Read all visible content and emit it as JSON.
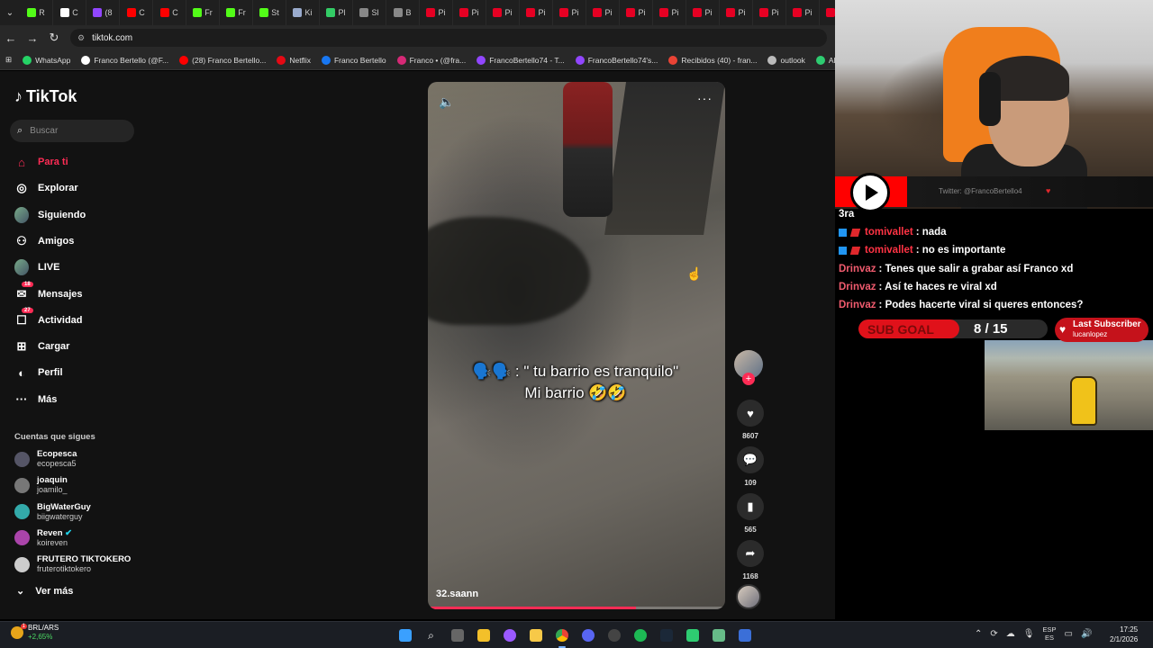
{
  "browser": {
    "tabs": [
      {
        "label": "R",
        "color": "#53fc18"
      },
      {
        "label": "C",
        "color": "#ffffff"
      },
      {
        "label": "(8",
        "color": "#9146ff"
      },
      {
        "label": "C",
        "color": "#ff0000"
      },
      {
        "label": "C",
        "color": "#ff0000"
      },
      {
        "label": "Fr",
        "color": "#53fc18"
      },
      {
        "label": "Fr",
        "color": "#53fc18"
      },
      {
        "label": "St",
        "color": "#53fc18"
      },
      {
        "label": "Ki",
        "color": "#9ac"
      },
      {
        "label": "Pl",
        "color": "#3c6"
      },
      {
        "label": "Sl",
        "color": "#888"
      },
      {
        "label": "B",
        "color": "#888"
      },
      {
        "label": "Pi",
        "color": "#e60023"
      },
      {
        "label": "Pi",
        "color": "#e60023"
      },
      {
        "label": "Pi",
        "color": "#e60023"
      },
      {
        "label": "Pi",
        "color": "#e60023"
      },
      {
        "label": "Pi",
        "color": "#e60023"
      },
      {
        "label": "Pi",
        "color": "#e60023"
      },
      {
        "label": "Pi",
        "color": "#e60023"
      },
      {
        "label": "Pi",
        "color": "#e60023"
      },
      {
        "label": "Pi",
        "color": "#e60023"
      },
      {
        "label": "Pi",
        "color": "#e60023"
      },
      {
        "label": "Pi",
        "color": "#e60023"
      },
      {
        "label": "Pi",
        "color": "#e60023"
      },
      {
        "label": "Pi",
        "color": "#e60023"
      }
    ],
    "url": "tiktok.com",
    "bookmarks": [
      {
        "label": "WhatsApp",
        "color": "#25d366"
      },
      {
        "label": "Franco Bertello (@F...",
        "color": "#ffffff"
      },
      {
        "label": "(28) Franco Bertello...",
        "color": "#ff0000"
      },
      {
        "label": "Netflix",
        "color": "#e50914"
      },
      {
        "label": "Franco Bertello",
        "color": "#1877f2"
      },
      {
        "label": "Franco • (@fra...",
        "color": "#d62976"
      },
      {
        "label": "FrancoBertello74 - T...",
        "color": "#9146ff"
      },
      {
        "label": "FrancoBertello74's...",
        "color": "#9146ff"
      },
      {
        "label": "Recibidos (40) - fran...",
        "color": "#ea4335"
      },
      {
        "label": "outlook",
        "color": "#bbbbbb"
      },
      {
        "label": "Aler",
        "color": "#2ecc71"
      }
    ]
  },
  "tiktok": {
    "logo": "TikTok",
    "search_placeholder": "Buscar",
    "nav": [
      {
        "label": "Para ti",
        "icon": "home-icon",
        "active": true
      },
      {
        "label": "Explorar",
        "icon": "compass-icon"
      },
      {
        "label": "Siguiendo",
        "icon": "avatar-icon"
      },
      {
        "label": "Amigos",
        "icon": "friends-icon"
      },
      {
        "label": "LIVE",
        "icon": "live-icon"
      },
      {
        "label": "Mensajes",
        "icon": "messages-icon",
        "badge": "18"
      },
      {
        "label": "Actividad",
        "icon": "activity-icon",
        "badge": "27"
      },
      {
        "label": "Cargar",
        "icon": "upload-icon"
      },
      {
        "label": "Perfil",
        "icon": "profile-icon"
      },
      {
        "label": "Más",
        "icon": "more-icon"
      }
    ],
    "following_title": "Cuentas que sigues",
    "accounts": [
      {
        "display": "Ecopesca",
        "user": "ecopesca5",
        "color": "#556"
      },
      {
        "display": "joaquin",
        "user": "joamilo_",
        "color": "#777"
      },
      {
        "display": "BigWaterGuy",
        "user": "biigwaterguy",
        "color": "#3aa"
      },
      {
        "display": "Reven",
        "user": "koireven",
        "color": "#a4a",
        "verified": true
      },
      {
        "display": "FRUTERO TIKTOKERO",
        "user": "fruterotiktokero",
        "color": "#ccc"
      }
    ],
    "see_more": "Ver más",
    "video": {
      "caption_line1": "🗣️🗣️ : \" tu barrio es tranquilo\"",
      "caption_line2": "Mi barrio 🤣🤣",
      "author": "32.saann",
      "progress": 0.7
    },
    "actions": {
      "likes": "8607",
      "comments": "109",
      "saves": "565",
      "shares": "1168"
    }
  },
  "stream": {
    "twitter": "Twitter: @FrancoBertello4",
    "chat": [
      {
        "user": "",
        "text": "3ra"
      },
      {
        "user": "tomivallet",
        "text": ": nada",
        "badges": true
      },
      {
        "user": "tomivallet",
        "text": ": no es importante",
        "badges": true
      },
      {
        "user": "Drinvaz",
        "text": ": Tenes que salir a grabar así Franco xd"
      },
      {
        "user": "Drinvaz",
        "text": ": Así te haces re viral xd"
      },
      {
        "user": "Drinvaz",
        "text": ": Podes hacerte viral si queres entonces?"
      }
    ],
    "subgoal_label": "SUB GOAL",
    "subgoal_count": "8 / 15",
    "subgoal_progress": 0.533,
    "last_sub_title": "Last Subscriber",
    "last_sub_user": "lucanlopez"
  },
  "taskbar": {
    "ticker_name": "BRL/ARS",
    "ticker_change": "+2,65%",
    "ticker_badge": "1",
    "lang_1": "ESP",
    "lang_2": "ES",
    "time": "17:25",
    "date": "2/1/2026"
  }
}
